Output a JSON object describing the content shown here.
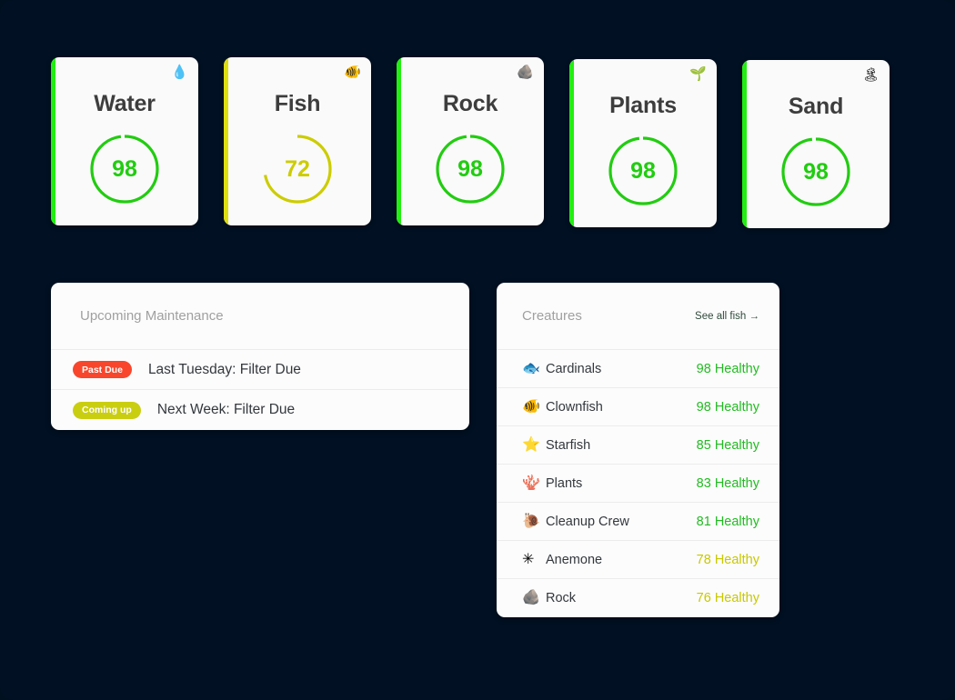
{
  "theme": {
    "background": "#011022",
    "card_bg": "#fafafa",
    "panel_bg": "#fcfcfc",
    "green": "#22cc11",
    "yellow": "#cccc00",
    "title_color": "#3d3d3d",
    "muted": "#a0a0a0",
    "divider": "#ececec"
  },
  "status_cards": [
    {
      "title": "Water",
      "value": 98,
      "icon": "💧",
      "icon_name": "water-drop-icon",
      "color": "#22cc11",
      "accent": "#22ee11"
    },
    {
      "title": "Fish",
      "value": 72,
      "icon": "🐠",
      "icon_name": "clownfish-icon",
      "color": "#cccc00",
      "accent": "#dddd11"
    },
    {
      "title": "Rock",
      "value": 98,
      "icon": "🪨",
      "icon_name": "rock-icon",
      "color": "#22cc11",
      "accent": "#22ee11"
    },
    {
      "title": "Plants",
      "value": 98,
      "icon": "🌱",
      "icon_name": "seedling-icon",
      "color": "#22cc11",
      "accent": "#22ee11"
    },
    {
      "title": "Sand",
      "value": 98,
      "icon": "🏝",
      "icon_name": "beach-icon",
      "color": "#22cc11",
      "accent": "#22ee11"
    }
  ],
  "maintenance": {
    "title": "Upcoming Maintenance",
    "rows": [
      {
        "badge": "Past Due",
        "badge_color": "#f8462c",
        "text": "Last Tuesday: Filter Due"
      },
      {
        "badge": "Coming up",
        "badge_color": "#cace10",
        "text": "Next Week: Filter Due"
      }
    ]
  },
  "creatures": {
    "title": "Creatures",
    "see_all_label": "See all fish →",
    "rows": [
      {
        "icon": "🐟",
        "icon_name": "fish-icon",
        "name": "Cardinals",
        "status": "98 Healthy",
        "color": "#22bb22"
      },
      {
        "icon": "🐠",
        "icon_name": "clownfish-icon",
        "name": "Clownfish",
        "status": "98 Healthy",
        "color": "#22bb22"
      },
      {
        "icon": "⭐",
        "icon_name": "starfish-icon",
        "name": "Starfish",
        "status": "85 Healthy",
        "color": "#22bb22"
      },
      {
        "icon": "🪸",
        "icon_name": "coral-icon",
        "name": "Plants",
        "status": "83 Healthy",
        "color": "#22bb22"
      },
      {
        "icon": "🐌",
        "icon_name": "snail-icon",
        "name": "Cleanup Crew",
        "status": "81 Healthy",
        "color": "#22bb22"
      },
      {
        "icon": "✳",
        "icon_name": "anemone-icon",
        "name": "Anemone",
        "status": "78 Healthy",
        "color": "#c8c800"
      },
      {
        "icon": "🪨",
        "icon_name": "rock-icon",
        "name": "Rock",
        "status": "76 Healthy",
        "color": "#c8c800"
      }
    ]
  }
}
